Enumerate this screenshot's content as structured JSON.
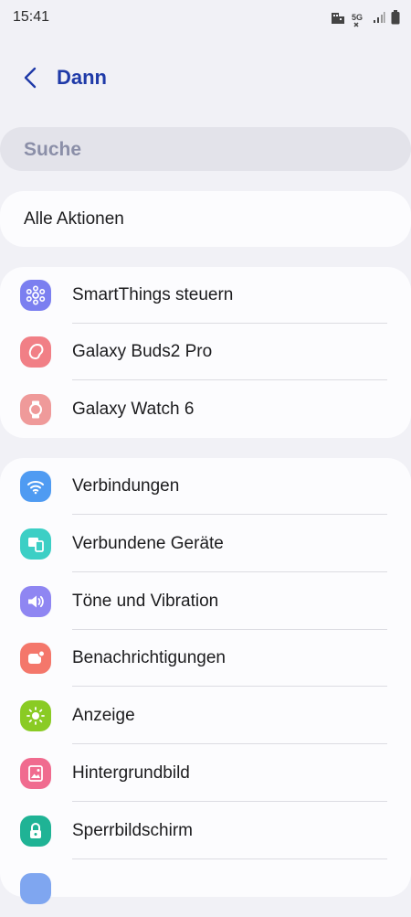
{
  "status_bar": {
    "time": "15:41",
    "network_label": "5G"
  },
  "header": {
    "title": "Dann"
  },
  "search": {
    "placeholder": "Suche"
  },
  "all_actions": {
    "label": "Alle Aktionen"
  },
  "devices": [
    {
      "label": "SmartThings steuern",
      "icon": "smartthings-icon",
      "color": "#7b7ff0"
    },
    {
      "label": "Galaxy Buds2 Pro",
      "icon": "galaxy-buds-icon",
      "color": "#f17f86"
    },
    {
      "label": "Galaxy Watch 6",
      "icon": "galaxy-watch-icon",
      "color": "#ef9a9a"
    }
  ],
  "settings": [
    {
      "label": "Verbindungen",
      "icon": "wifi-icon",
      "color": "#4f9bf2"
    },
    {
      "label": "Verbundene Geräte",
      "icon": "connected-devices-icon",
      "color": "#3ccfc5"
    },
    {
      "label": "Töne und Vibration",
      "icon": "speaker-icon",
      "color": "#8f86f2"
    },
    {
      "label": "Benachrichtigungen",
      "icon": "notification-icon",
      "color": "#f4776b"
    },
    {
      "label": "Anzeige",
      "icon": "brightness-icon",
      "color": "#8acb24"
    },
    {
      "label": "Hintergrundbild",
      "icon": "wallpaper-icon",
      "color": "#f06b8f"
    },
    {
      "label": "Sperrbildschirm",
      "icon": "lock-icon",
      "color": "#1fb395"
    }
  ]
}
